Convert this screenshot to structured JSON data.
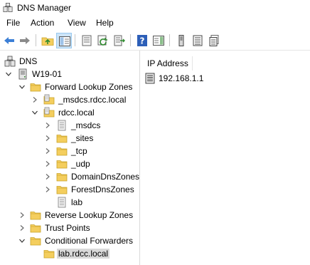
{
  "window": {
    "title": "DNS Manager"
  },
  "menu": {
    "items": [
      "File",
      "Action",
      "View",
      "Help"
    ]
  },
  "toolbar": {
    "buttons": [
      "back",
      "forward",
      "up-folder",
      "show-hide-tree",
      "properties",
      "refresh",
      "export-list",
      "help",
      "show-action-pane",
      "server-record",
      "zone-list",
      "records-list"
    ]
  },
  "tree": {
    "root": "DNS",
    "server": "W19-01",
    "forward_zones": "Forward Lookup Zones",
    "msdcs_zone": "_msdcs.rdcc.local",
    "rdcc_zone": "rdcc.local",
    "sub_msdcs": "_msdcs",
    "sub_sites": "_sites",
    "sub_tcp": "_tcp",
    "sub_udp": "_udp",
    "sub_domaindns": "DomainDnsZones",
    "sub_forestdns": "ForestDnsZones",
    "record_lab": "lab",
    "reverse_zones": "Reverse Lookup Zones",
    "trust_points": "Trust Points",
    "conditional_forwarders": "Conditional Forwarders",
    "forwarder_lab": "lab.rdcc.local"
  },
  "details": {
    "column_header": "IP Address",
    "rows": [
      "192.168.1.1"
    ]
  },
  "colors": {
    "folder": "#f4ce5e",
    "arrow": "#3c7fd6",
    "selection": "#d9d9d9"
  }
}
